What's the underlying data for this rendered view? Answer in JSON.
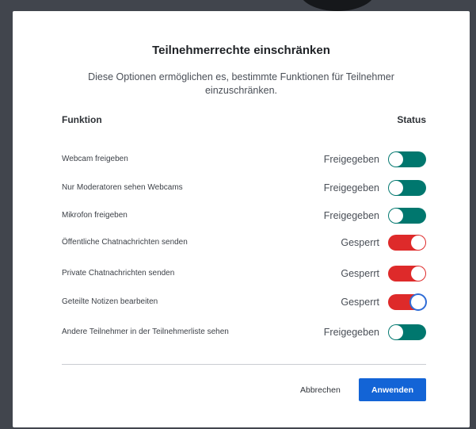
{
  "dialog": {
    "title": "Teilnehmerrechte einschränken",
    "description": "Diese Optionen ermöglichen es, bestimmte Funktionen für Teilnehmer einzuschränken."
  },
  "columns": {
    "funktion": "Funktion",
    "status": "Status"
  },
  "rows": [
    {
      "label": "Webcam freigeben",
      "status": "Freigegeben",
      "enabled": true
    },
    {
      "label": "Nur Moderatoren sehen Webcams",
      "status": "Freigegeben",
      "enabled": true
    },
    {
      "label": "Mikrofon freigeben",
      "status": "Freigegeben",
      "enabled": true
    },
    {
      "label": "Öffentliche Chatnachrichten senden",
      "status": "Gesperrt",
      "enabled": false
    },
    {
      "label": "Private Chatnachrichten senden",
      "status": "Gesperrt",
      "enabled": false
    },
    {
      "label": "Geteilte Notizen bearbeiten",
      "status": "Gesperrt",
      "enabled": false
    },
    {
      "label": "Andere Teilnehmer in der Teilnehmerliste sehen",
      "status": "Freigegeben",
      "enabled": true
    }
  ],
  "buttons": {
    "cancel": "Abbrechen",
    "apply": "Anwenden"
  },
  "colors": {
    "toggle_on": "#00776e",
    "toggle_off": "#de2a2a",
    "primary": "#1364d6",
    "focus_ring": "#2f6cd6"
  }
}
